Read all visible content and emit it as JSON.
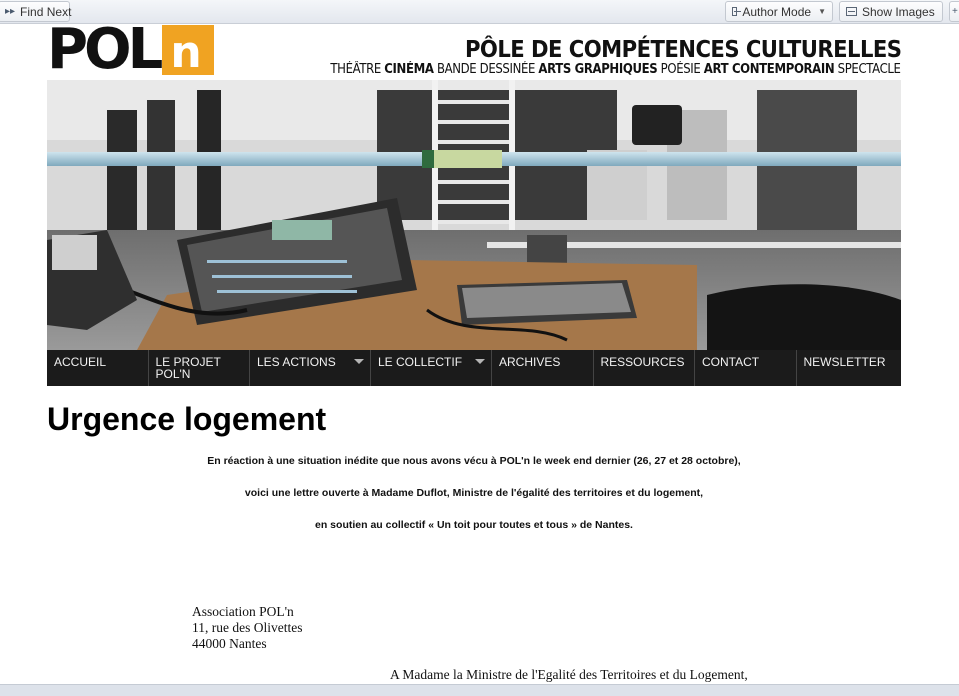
{
  "toolbar": {
    "find_next": "Find Next",
    "author_mode": "Author Mode",
    "show_images": "Show Images"
  },
  "header": {
    "logo_text": "POL",
    "logo_accent": "n",
    "tagline": "PÔLE DE COMPÉTENCES CULTURELLES",
    "disciplines": [
      {
        "text": "THÉÂTRE",
        "bold": false
      },
      {
        "text": "CINÉMA",
        "bold": true
      },
      {
        "text": "BANDE DESSINÉE",
        "bold": false
      },
      {
        "text": "ARTS GRAPHIQUES",
        "bold": true
      },
      {
        "text": "POÉSIE",
        "bold": false
      },
      {
        "text": "ART CONTEMPORAIN",
        "bold": true
      },
      {
        "text": "SPECTACLE",
        "bold": false
      }
    ]
  },
  "nav": [
    {
      "label": "ACCUEIL",
      "dropdown": false
    },
    {
      "label": "LE PROJET\nPOL'N",
      "dropdown": false
    },
    {
      "label": "LES ACTIONS",
      "dropdown": true
    },
    {
      "label": "LE COLLECTIF",
      "dropdown": true
    },
    {
      "label": "ARCHIVES",
      "dropdown": false
    },
    {
      "label": "RESSOURCES",
      "dropdown": false
    },
    {
      "label": "CONTACT",
      "dropdown": false
    },
    {
      "label": "NEWSLETTER",
      "dropdown": false
    }
  ],
  "article": {
    "title": "Urgence logement",
    "intro": [
      "En réaction à une situation inédite que nous avons vécu à POL'n le week end dernier (26, 27 et 28 octobre),",
      "voici une lettre ouverte à Madame Duflot, Ministre de l'égalité des territoires et du logement,",
      "en soutien au collectif « Un toit pour toutes et tous » de Nantes."
    ],
    "address": [
      "Association POL'n",
      "11, rue des Olivettes",
      "44000 Nantes"
    ],
    "recipient": "A Madame la Ministre de l'Egalité des Territoires et du Logement,"
  },
  "colors": {
    "logo_accent": "#f0a322",
    "nav_background": "#1b1b1b"
  }
}
